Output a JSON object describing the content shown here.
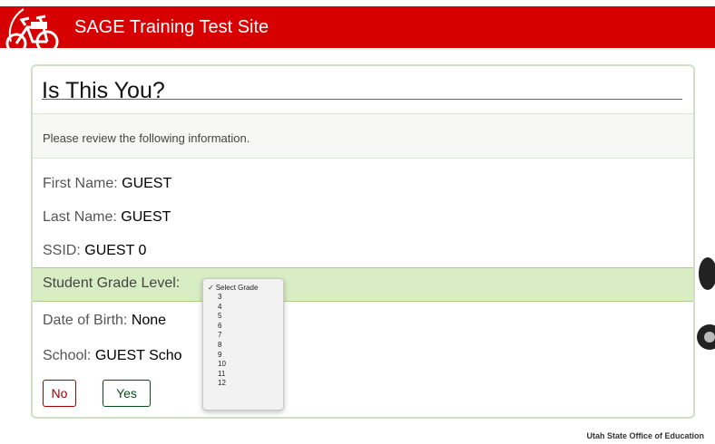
{
  "header": {
    "title": "SAGE Training Test Site",
    "bar_color": "#d60000",
    "logo_icon": "bicycle-icon"
  },
  "card": {
    "title": "Is This You?",
    "notice": "Please review the following information.",
    "fields": {
      "first_name": {
        "label": "First Name:",
        "value": "GUEST"
      },
      "last_name": {
        "label": "Last Name:",
        "value": "GUEST"
      },
      "ssid": {
        "label": "SSID:",
        "value": "GUEST 0"
      },
      "grade": {
        "label": "Student Grade Level:"
      },
      "dob": {
        "label": "Date of Birth:",
        "value": "None"
      },
      "school": {
        "label": "School:",
        "value": "GUEST Scho"
      }
    },
    "buttons": {
      "no": "No",
      "yes": "Yes"
    }
  },
  "grade_dropdown": {
    "selected": "Select Grade",
    "check_glyph": "✓",
    "options": [
      "3",
      "4",
      "5",
      "6",
      "7",
      "8",
      "9",
      "10",
      "11",
      "12"
    ]
  },
  "footer": {
    "text": "Utah State Office of Education"
  }
}
